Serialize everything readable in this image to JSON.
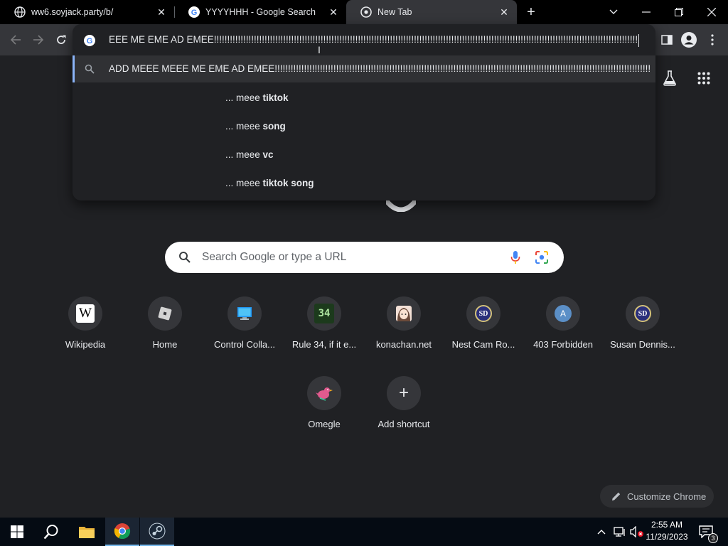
{
  "tabs": [
    {
      "title": "ww6.soyjack.party/b/",
      "active": false
    },
    {
      "title": "YYYYHHH - Google Search",
      "active": false
    },
    {
      "title": "New Tab",
      "active": true
    }
  ],
  "omnibox": {
    "value": "EEE ME EME AD EMEE!!!!!!!!!!!!!!!!!!!!!!!!!!!!!!!!!!!!!!!!!!!!!!!!!!!!!!!!!!!!!!!!!!!!!!!!!!!!!!!!!!!!!!!!!!!!!!!!!!!!!!!!!!!!!!!!!!!!!!!!!!!!!!!!!!!!!!!!!!!!!!!!!!!!!!!!!!!!!!!!!!!!!!!!!!!!!!!!!!!!",
    "suggestions": [
      {
        "text": "ADD MEEE MEEE ME EME AD EMEE!!!!!!!!!!!!!!!!!!!!!!!!!!!!!!!!!!!!!!!!!!!!!!!!!!!!!!!!!!!!!!!!!!!!!!!!!!!!!!!!!!!!!!!!!!!!!!!!!!!!!!!!!!!!!!!!!!!!!!!!!!!!!!!!!!!!!!!!!!!!!!!!!!!!!!!!!!!!!!!!!!!!!!!!!!!!!!!!!..."
      },
      {
        "prefix": "... meee ",
        "bold": "tiktok"
      },
      {
        "prefix": "... meee ",
        "bold": "song"
      },
      {
        "prefix": "... meee ",
        "bold": "vc"
      },
      {
        "prefix": "... meee ",
        "bold": "tiktok song"
      }
    ]
  },
  "search": {
    "placeholder": "Search Google or type a URL"
  },
  "shortcuts": [
    {
      "label": "Wikipedia",
      "icon": "W"
    },
    {
      "label": "Home",
      "icon": ""
    },
    {
      "label": "Control Colla...",
      "icon": ""
    },
    {
      "label": "Rule 34, if it e...",
      "icon": "34"
    },
    {
      "label": "konachan.net",
      "icon": ""
    },
    {
      "label": "Nest Cam Ro...",
      "icon": "SD"
    },
    {
      "label": "403 Forbidden",
      "icon": "A"
    },
    {
      "label": "Susan Dennis...",
      "icon": "SD"
    },
    {
      "label": "Omegle",
      "icon": ""
    },
    {
      "label": "Add shortcut",
      "icon": "+"
    }
  ],
  "customize": {
    "label": "Customize Chrome"
  },
  "clock": {
    "time": "2:55 AM",
    "date": "11/29/2023"
  },
  "notifications": {
    "count": "3"
  },
  "colors": {
    "accent": "#8ab4f8",
    "background": "#202124",
    "toolbar": "#35363a"
  }
}
